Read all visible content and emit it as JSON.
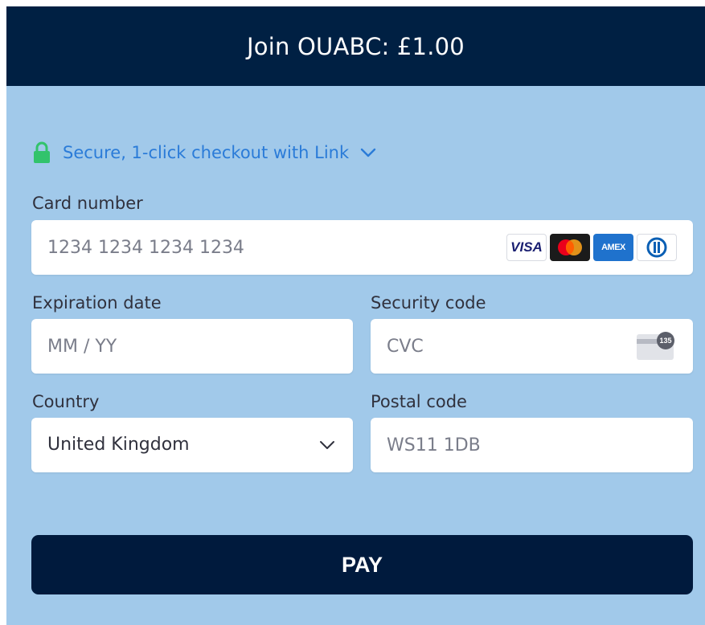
{
  "header": {
    "title": "Join OUABC: £1.00"
  },
  "link": {
    "text": "Secure, 1-click checkout with Link"
  },
  "card_number": {
    "label": "Card number",
    "placeholder": "1234 1234 1234 1234"
  },
  "card_brands": [
    {
      "name": "visa",
      "text": "VISA"
    },
    {
      "name": "mastercard",
      "text": ""
    },
    {
      "name": "amex",
      "text": "AMEX"
    },
    {
      "name": "diners",
      "text": ""
    }
  ],
  "expiration": {
    "label": "Expiration date",
    "placeholder": "MM / YY"
  },
  "security": {
    "label": "Security code",
    "placeholder": "CVC",
    "badge": "135"
  },
  "country": {
    "label": "Country",
    "value": "United Kingdom"
  },
  "postal": {
    "label": "Postal code",
    "placeholder": "WS11 1DB"
  },
  "pay": {
    "label": "PAY"
  },
  "colors": {
    "header_bg": "#002043",
    "panel_bg": "#a1c9ea",
    "link": "#2a7bd8",
    "lock": "#32c36c",
    "button_bg": "#001a3d"
  }
}
